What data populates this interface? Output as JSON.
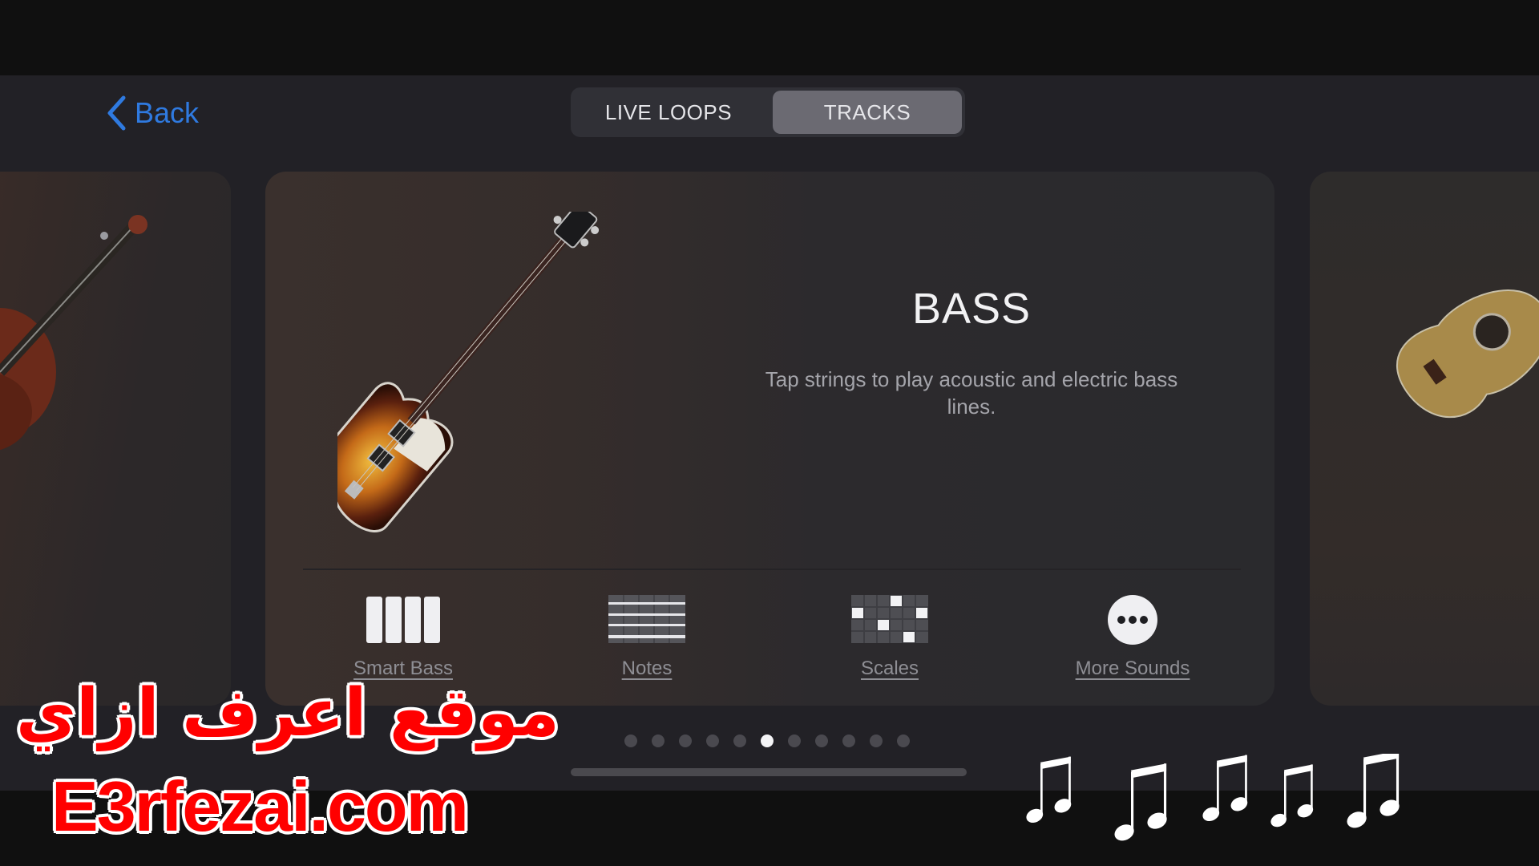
{
  "header": {
    "back_label": "Back",
    "segments": [
      {
        "label": "LIVE LOOPS",
        "selected": false
      },
      {
        "label": "TRACKS",
        "selected": true
      }
    ]
  },
  "carousel": {
    "previous_instrument": "violin",
    "next_instrument": "acoustic-guitar",
    "current": {
      "instrument": "bass-guitar",
      "title": "BASS",
      "description": "Tap strings to play acoustic and electric bass lines.",
      "options": [
        {
          "label": "Smart Bass",
          "icon": "smart-bass-icon"
        },
        {
          "label": "Notes",
          "icon": "notes-grid-icon"
        },
        {
          "label": "Scales",
          "icon": "scales-grid-icon"
        },
        {
          "label": "More Sounds",
          "icon": "more-icon"
        }
      ]
    },
    "page_count": 11,
    "current_page": 6
  },
  "watermark": {
    "arabic": "موقع اعرف ازاي",
    "site": "E3rfezai.com",
    "music_notes_count": 5
  },
  "colors": {
    "accent_blue": "#2f7ae0",
    "watermark_red": "#ff0000"
  }
}
